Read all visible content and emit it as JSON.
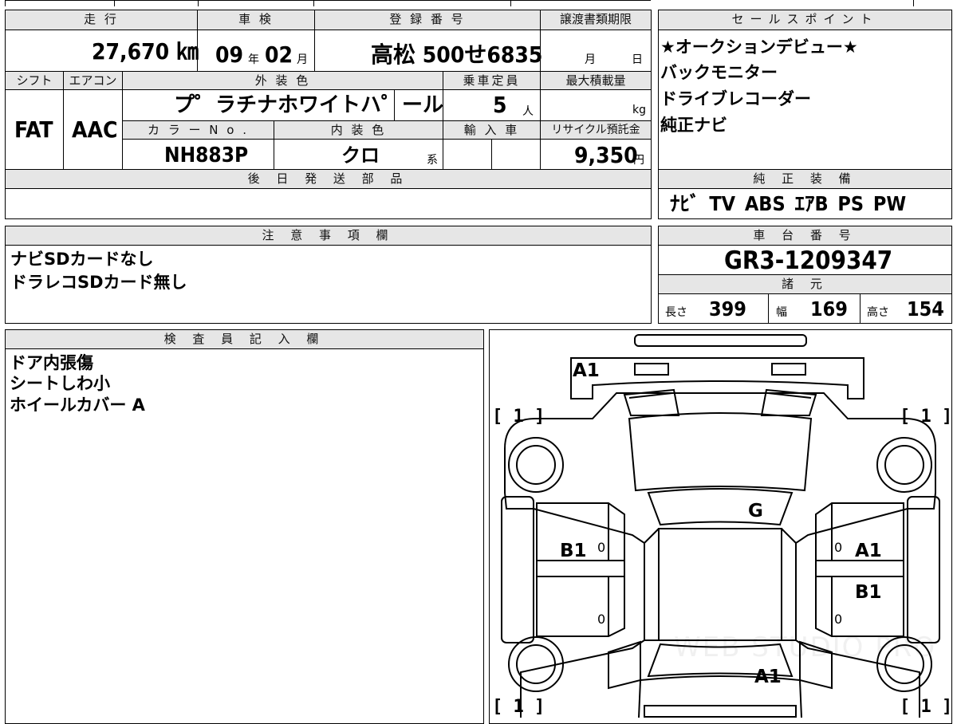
{
  "vehicle_info": {
    "mileage_label": "走 行",
    "mileage_value": "27,670 ㎞",
    "inspection_label": "車 検",
    "inspection_year": "09",
    "inspection_year_unit": "年",
    "inspection_month": "02",
    "inspection_month_unit": "月",
    "registration_label": "登 録 番 号",
    "registration_value": "高松 500せ6835",
    "transfer_docs_label": "譲渡書類期限",
    "transfer_month_unit": "月",
    "transfer_day_unit": "日",
    "shift_label": "シフト",
    "shift_value": "FAT",
    "aircon_label": "エアコン",
    "aircon_value": "AAC",
    "exterior_color_label": "外 装 色",
    "exterior_color_value": "プ゜ラチナホワイトハ゜ール",
    "capacity_label": "乗車定員",
    "capacity_value": "5",
    "capacity_unit": "人",
    "max_load_label": "最大積載量",
    "max_load_unit": "kg",
    "color_no_label": "カ ラ ー N o .",
    "color_no_value": "NH883P",
    "interior_color_label": "内 装 色",
    "interior_color_value": "クロ",
    "interior_color_suffix": "系",
    "import_label": "輸 入 車",
    "recycle_label": "リサイクル預託金",
    "recycle_value": "9,350",
    "recycle_unit": "円",
    "later_parts_label": "後 日 発 送 部 品"
  },
  "sales_points": {
    "label": "セールスポイント",
    "items": [
      "★オークションデビュー★",
      "バックモニター",
      "ドライブレコーダー",
      "純正ナビ"
    ]
  },
  "genuine_equipment": {
    "label": "純 正 装 備",
    "value": "ﾅﾋﾞ TV ABS ｴｱB PS PW"
  },
  "caution": {
    "label": "注 意 事 項 欄",
    "lines": [
      "ナビSDカードなし",
      "ドラレコSDカード無し"
    ]
  },
  "chassis": {
    "label": "車 台 番 号",
    "value": "GR3-1209347"
  },
  "specs": {
    "label": "諸 元",
    "length_label": "長さ",
    "length_value": "399",
    "width_label": "幅",
    "width_value": "169",
    "height_label": "高さ",
    "height_value": "154"
  },
  "inspector": {
    "label": "検 査 員 記 入 欄",
    "lines": [
      "ドア内張傷",
      "シートしわ小",
      "ホイールカバー A"
    ]
  },
  "damage_map": {
    "front_bumper": "A1",
    "hood": "G",
    "left_front_door": "B1",
    "right_front_door": "A1",
    "right_rear_door": "B1",
    "rear": "A1",
    "wheel_mark": "[ 1 ]",
    "zero_mark": "0",
    "watermark": "WEB STUDIO PRO"
  }
}
